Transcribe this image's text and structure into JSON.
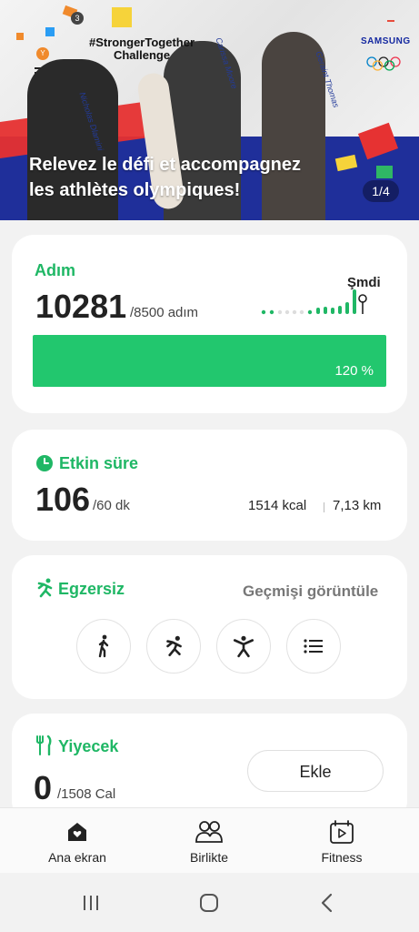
{
  "banner": {
    "challenge_title_1": "#StrongerTogether",
    "challenge_title_2": "Challenge",
    "headline": "Relevez le défi et accompagnez les athlètes olympiques!",
    "pager": "1/4",
    "sponsor": "SAMSUNG",
    "athletes": [
      "Nicholas Dlamini",
      "Carissa Moore",
      "Geraint Thomas"
    ],
    "notification_count": "3"
  },
  "steps": {
    "title": "Adım",
    "value": "10281",
    "goal": "/8500 adım",
    "now_label": "Şmdi",
    "percent": "120 %",
    "percent_value": 120
  },
  "active": {
    "title": "Etkin süre",
    "value": "106",
    "goal": "/60 dk",
    "kcal": "1514 kcal",
    "distance": "7,13 km"
  },
  "exercise": {
    "title": "Egzersiz",
    "history_link": "Geçmişi görüntüle",
    "buttons": [
      "walk-icon",
      "run-icon",
      "workout-icon",
      "list-icon"
    ]
  },
  "food": {
    "title": "Yiyecek",
    "value": "0",
    "goal": "/1508 Cal",
    "add_label": "Ekle"
  },
  "nav": {
    "home": "Ana ekran",
    "together": "Birlikte",
    "fitness": "Fitness"
  },
  "colors": {
    "accent": "#1fb765",
    "progress": "#22c76e",
    "banner_blue": "#1f2f9a"
  }
}
